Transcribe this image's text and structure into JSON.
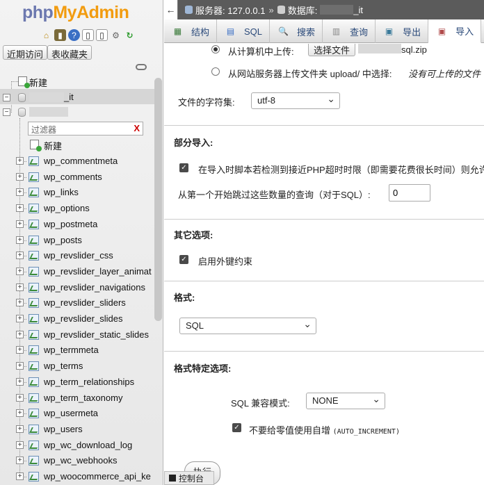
{
  "nav": {
    "logo": {
      "php": "php",
      "my": "My",
      "admin": "Admin"
    },
    "recent_label": "近期访问",
    "favorites_label": "表收藏夹",
    "new_label": "新建",
    "db1_name_suffix": "_it",
    "filter_placeholder": "过滤器",
    "filter_clear": "X",
    "db_new_label": "新建",
    "tables": [
      "wp_commentmeta",
      "wp_comments",
      "wp_links",
      "wp_options",
      "wp_postmeta",
      "wp_posts",
      "wp_revslider_css",
      "wp_revslider_layer_animat",
      "wp_revslider_navigations",
      "wp_revslider_sliders",
      "wp_revslider_slides",
      "wp_revslider_static_slides",
      "wp_termmeta",
      "wp_terms",
      "wp_term_relationships",
      "wp_term_taxonomy",
      "wp_usermeta",
      "wp_users",
      "wp_wc_download_log",
      "wp_wc_webhooks",
      "wp_woocommerce_api_ke"
    ]
  },
  "topbar": {
    "back": "←",
    "server_label": "服务器: 127.0.0.1",
    "sep": "»",
    "db_label": "数据库:",
    "db_suffix": "_it"
  },
  "tabs": [
    {
      "label": "结构",
      "icon": "structure-icon"
    },
    {
      "label": "SQL",
      "icon": "sql-icon"
    },
    {
      "label": "搜索",
      "icon": "search-icon"
    },
    {
      "label": "查询",
      "icon": "query-icon"
    },
    {
      "label": "导出",
      "icon": "export-icon"
    },
    {
      "label": "导入",
      "icon": "import-icon"
    }
  ],
  "import": {
    "upload_label": "从计算机中上传:",
    "choose_file": "选择文件",
    "file_name": "sql.zip",
    "server_upload_label": "从网站服务器上传文件夹 upload/ 中选择:",
    "server_upload_note": "没有可上传的文件",
    "charset_label": "文件的字符集:",
    "charset_value": "utf-8",
    "partial_title": "部分导入:",
    "timeout_label": "在导入时脚本若检测到接近PHP超时时限（即需要花费很长时间）则允许",
    "skip_label": "从第一个开始跳过这些数量的查询（对于SQL）:",
    "skip_value": "0",
    "other_title": "其它选项:",
    "fk_label": "启用外键约束",
    "format_title": "格式:",
    "format_value": "SQL",
    "format_options_title": "格式特定选项:",
    "compat_label": "SQL 兼容模式:",
    "compat_value": "NONE",
    "auto_inc_label": "不要给零值使用自增",
    "auto_inc_code": "(AUTO_INCREMENT)",
    "go_label": "执行"
  },
  "console": {
    "label": "控制台"
  }
}
